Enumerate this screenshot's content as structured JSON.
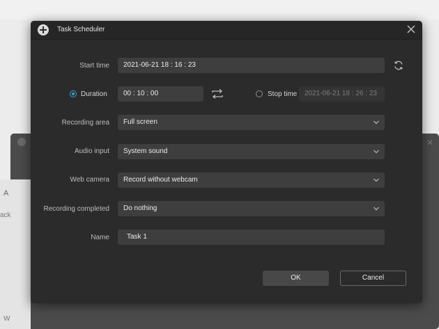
{
  "background": {
    "left_text_1": "A",
    "left_text_2": "ack",
    "left_text_3": "W"
  },
  "dialog": {
    "title": "Task Scheduler",
    "icons": {
      "title": "add-circle-icon",
      "close": "close-icon",
      "refresh": "refresh-icon",
      "swap": "swap-arrows-icon",
      "dropdown": "chevron-down-icon"
    },
    "accent_color": "#34a2d8",
    "start_time": {
      "label": "Start time",
      "value": "2021-06-21 18 : 16 : 23"
    },
    "duration": {
      "label": "Duration",
      "value": "00 : 10 : 00",
      "selected": true
    },
    "stop_time": {
      "label": "Stop time",
      "value": "2021-06-21 18 : 26 : 23",
      "selected": false
    },
    "recording_area": {
      "label": "Recording area",
      "value": "Full screen"
    },
    "audio_input": {
      "label": "Audio input",
      "value": "System sound"
    },
    "web_camera": {
      "label": "Web camera",
      "value": "Record without webcam"
    },
    "recording_completed": {
      "label": "Recording completed",
      "value": "Do nothing"
    },
    "name": {
      "label": "Name",
      "value": "Task 1"
    },
    "ok_label": "OK",
    "cancel_label": "Cancel"
  }
}
